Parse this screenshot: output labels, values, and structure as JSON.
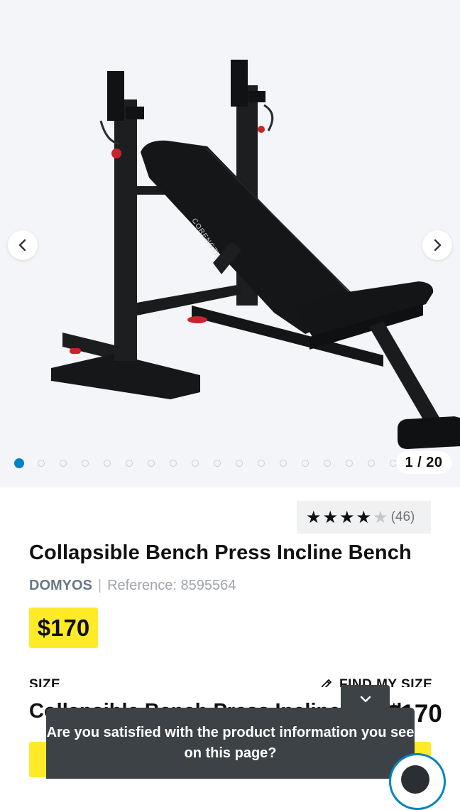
{
  "gallery": {
    "prev_icon": "chevron-left-icon",
    "next_icon": "chevron-right-icon",
    "counter": "1 / 20",
    "dot_count": 20,
    "active_index": 0,
    "product_image_brand_text": "CORENGTH",
    "accent_color": "#0082c3"
  },
  "product": {
    "rating": 4,
    "rating_max": 5,
    "rating_count": "(46)",
    "title": "Collapsible Bench Press Incline Bench",
    "brand": "DOMYOS",
    "separator": "|",
    "reference": "Reference: 8595564",
    "price": "$170",
    "price_bg_color": "#ffea28"
  },
  "size": {
    "label": "SIZE",
    "find_my_size": "FIND MY SIZE",
    "find_icon": "ruler-pencil-icon"
  },
  "sticky_bar": {
    "title": "Collapsible Bench Press Incline Bench",
    "price": "$170"
  },
  "survey": {
    "toggle_icon": "chevron-down-icon",
    "question": "Are you satisfied with the product information you see on this page?",
    "bg_color": "#3d4246"
  },
  "chat": {
    "icon": "chat-assistant-icon"
  }
}
